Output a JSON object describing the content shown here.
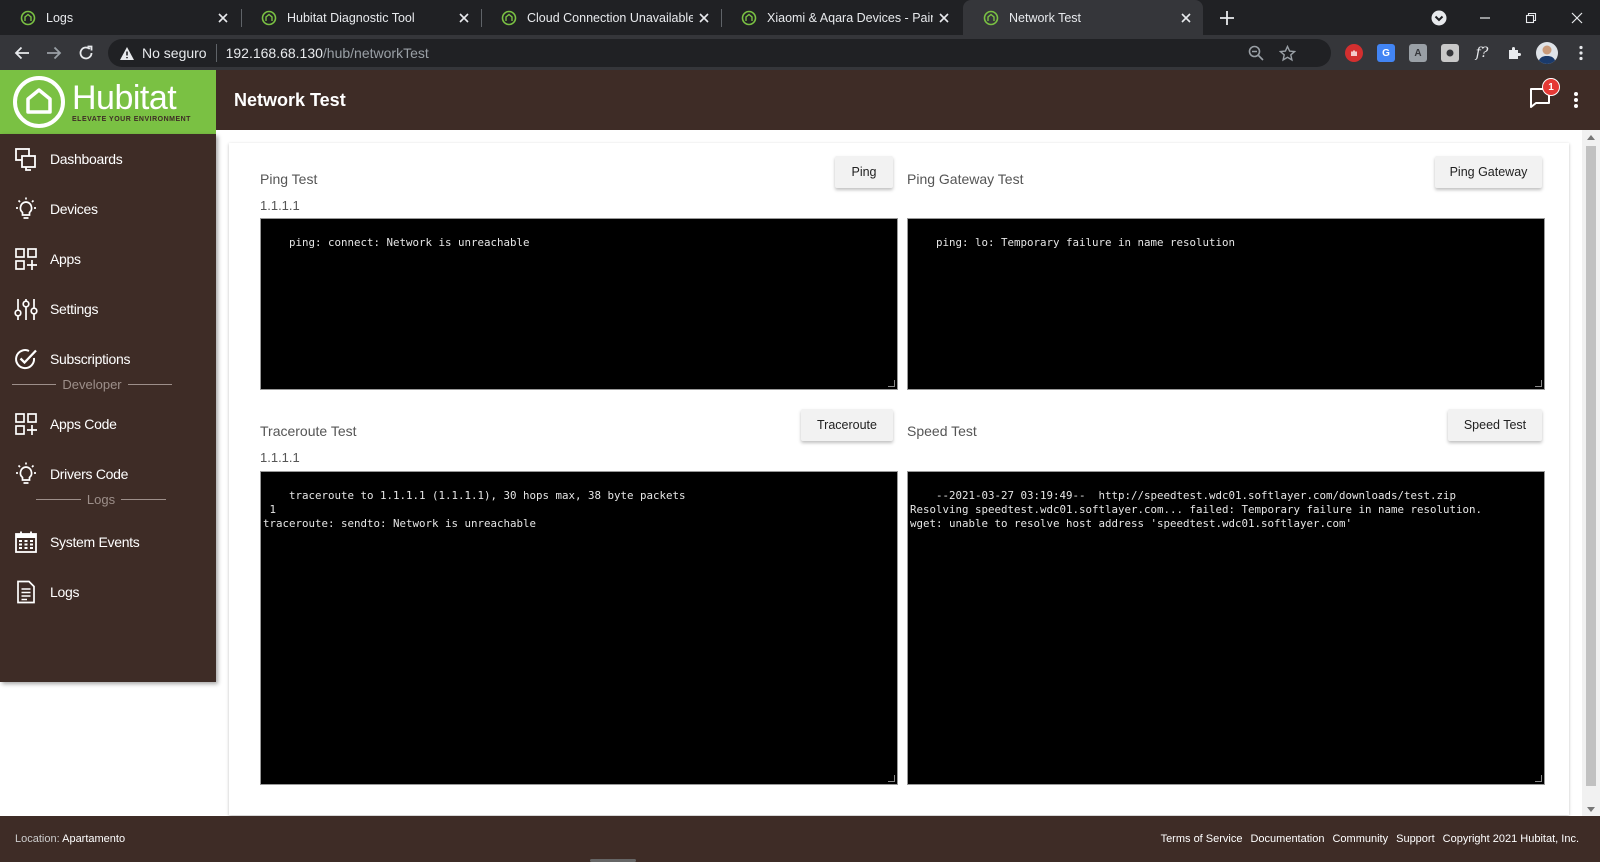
{
  "browser": {
    "tabs": [
      {
        "title": "Logs",
        "active": false
      },
      {
        "title": "Hubitat Diagnostic Tool",
        "active": false
      },
      {
        "title": "Cloud Connection Unavailable af",
        "active": false
      },
      {
        "title": "Xiaomi & Aqara Devices - Pairing",
        "active": false
      },
      {
        "title": "Network Test",
        "active": true
      }
    ],
    "security_label": "No seguro",
    "url_host": "192.168.68.130",
    "url_path": "/hub/networkTest"
  },
  "app": {
    "logo_name": "Hubitat",
    "logo_tagline": "ELEVATE YOUR ENVIRONMENT",
    "page_title": "Network Test",
    "notification_count": "1",
    "brand_green": "#7ac143",
    "brand_brown": "#3e2c26"
  },
  "sidebar": {
    "items": [
      {
        "label": "Dashboards",
        "icon": "dashboards-icon"
      },
      {
        "label": "Devices",
        "icon": "devices-icon"
      },
      {
        "label": "Apps",
        "icon": "apps-icon"
      },
      {
        "label": "Settings",
        "icon": "settings-icon"
      },
      {
        "label": "Subscriptions",
        "icon": "subscriptions-icon"
      }
    ],
    "developer_section": "Developer",
    "developer_items": [
      {
        "label": "Apps Code",
        "icon": "apps-code-icon"
      },
      {
        "label": "Drivers Code",
        "icon": "drivers-code-icon"
      }
    ],
    "logs_section": "Logs",
    "logs_items": [
      {
        "label": "System Events",
        "icon": "calendar-icon"
      },
      {
        "label": "Logs",
        "icon": "document-icon"
      }
    ]
  },
  "panels": {
    "ping": {
      "title": "Ping Test",
      "target": "1.1.1.1",
      "button": "Ping",
      "output": "ping: connect: Network is unreachable"
    },
    "ping_gateway": {
      "title": "Ping Gateway Test",
      "button": "Ping Gateway",
      "output": "ping: lo: Temporary failure in name resolution"
    },
    "traceroute": {
      "title": "Traceroute Test",
      "target": "1.1.1.1",
      "button": "Traceroute",
      "output": "traceroute to 1.1.1.1 (1.1.1.1), 30 hops max, 38 byte packets\n 1\ntraceroute: sendto: Network is unreachable"
    },
    "speed": {
      "title": "Speed Test",
      "button": "Speed Test",
      "output": "--2021-03-27 03:19:49--  http://speedtest.wdc01.softlayer.com/downloads/test.zip\nResolving speedtest.wdc01.softlayer.com... failed: Temporary failure in name resolution.\nwget: unable to resolve host address 'speedtest.wdc01.softlayer.com'"
    }
  },
  "footer": {
    "location_label": "Location:",
    "location_value": "Apartamento",
    "links": [
      "Terms of Service",
      "Documentation",
      "Community",
      "Support"
    ],
    "copyright": "Copyright 2021 Hubitat, Inc."
  }
}
